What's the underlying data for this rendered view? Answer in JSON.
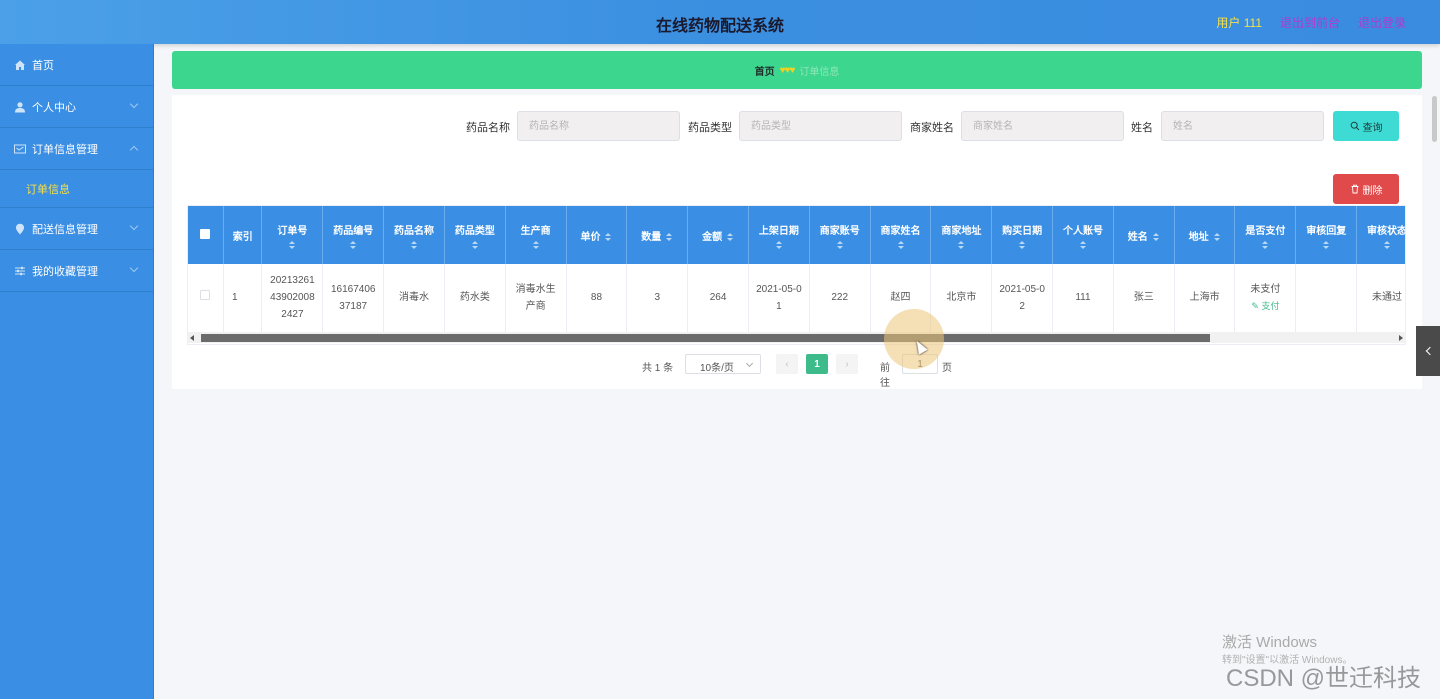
{
  "header": {
    "title": "在线药物配送系统",
    "user": "用户 111",
    "front_link": "退出到前台",
    "logout": "退出登录"
  },
  "sidebar": {
    "items": [
      {
        "label": "首页",
        "icon": "home-icon"
      },
      {
        "label": "个人中心",
        "icon": "user-icon"
      },
      {
        "label": "订单信息管理",
        "icon": "order-icon"
      },
      {
        "label": "订单信息",
        "icon": ""
      },
      {
        "label": "配送信息管理",
        "icon": "location-icon"
      },
      {
        "label": "我的收藏管理",
        "icon": "sliders-icon"
      }
    ]
  },
  "breadcrumb": {
    "home": "首页",
    "separator": "♥♥♥",
    "current": "订单信息"
  },
  "search": {
    "drug_name_label": "药品名称",
    "drug_name_placeholder": "药品名称",
    "drug_type_label": "药品类型",
    "drug_type_placeholder": "药品类型",
    "merchant_name_label": "商家姓名",
    "merchant_name_placeholder": "商家姓名",
    "name_label": "姓名",
    "name_placeholder": "姓名",
    "search_button": "查询",
    "delete_button": "删除"
  },
  "table": {
    "columns": [
      "索引",
      "订单号",
      "药品编号",
      "药品名称",
      "药品类型",
      "生产商",
      "单价",
      "数量",
      "金额",
      "上架日期",
      "商家账号",
      "商家姓名",
      "商家地址",
      "购买日期",
      "个人账号",
      "姓名",
      "地址",
      "是否支付",
      "审核回复",
      "审核状态"
    ],
    "rows": [
      {
        "index": "1",
        "order_no": "20213261439020082427",
        "drug_no": "1616740637187",
        "drug_name": "消毒水",
        "drug_type": "药水类",
        "manufacturer": "消毒水生产商",
        "price": "88",
        "qty": "3",
        "amount": "264",
        "list_date": "2021-05-01",
        "merchant_account": "222",
        "merchant_name": "赵四",
        "merchant_address": "北京市",
        "buy_date": "2021-05-02",
        "personal_account": "111",
        "name": "张三",
        "address": "上海市",
        "paid": "未支付",
        "pay_action": "支付",
        "review_reply": "",
        "review_status": "未通过"
      }
    ]
  },
  "pagination": {
    "total": "共 1 条",
    "page_size": "10条/页",
    "current_page": "1",
    "goto_label": "前往",
    "goto_value": "1",
    "page_suffix": "页"
  },
  "watermark": {
    "activate": "激活 Windows",
    "activate_hint": "转到\"设置\"以激活 Windows。",
    "csdn": "CSDN @世迁科技"
  },
  "colors": {
    "header": "#3b8fe0",
    "sidebar": "#3a8ee3",
    "breadcrumb": "#3dd68f",
    "search_button": "#3ddbd4",
    "delete_button": "#e04a4a",
    "pager_active": "#3dbb8a"
  }
}
